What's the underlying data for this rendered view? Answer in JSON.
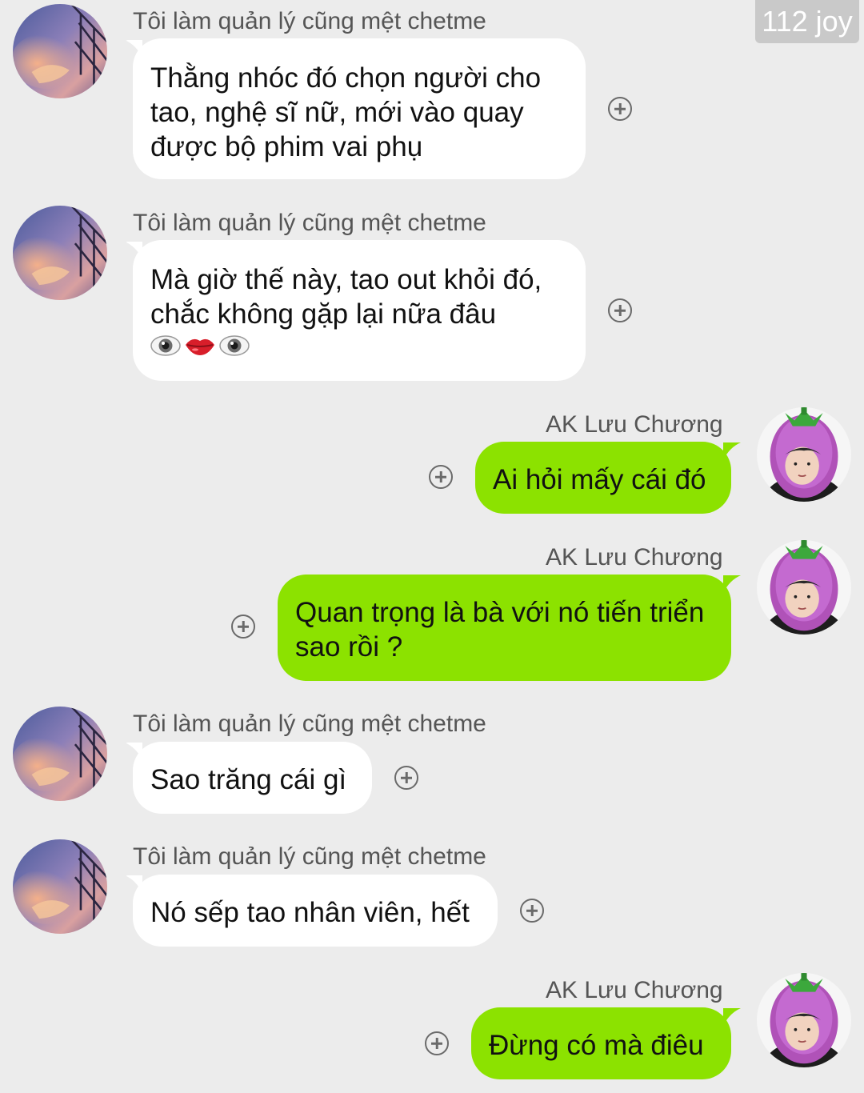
{
  "watermark": "112 joy",
  "colors": {
    "background": "#ececec",
    "incoming_bubble": "#ffffff",
    "outgoing_bubble": "#8ce200"
  },
  "contacts": {
    "other": {
      "name": "Tôi làm quản lý cũng mệt chetme",
      "avatar_icon": "sunset-building-avatar"
    },
    "me": {
      "name": "AK Lưu Chương",
      "avatar_icon": "eggplant-hat-avatar"
    }
  },
  "messages": [
    {
      "sender": "Tôi làm quản lý cũng mệt chetme",
      "lines": [
        "Thằng nhóc đó chọn người cho",
        "tao, nghệ sĩ nữ, mới vào quay",
        "được bộ phim vai phụ"
      ]
    },
    {
      "sender": "Tôi làm quản lý cũng mệt chetme",
      "lines": [
        "Mà giờ thế này, tao out khỏi đó,",
        "chắc không gặp lại nữa đâu"
      ],
      "emoji": [
        "eye-emoji",
        "lips-emoji",
        "eye-emoji"
      ]
    },
    {
      "sender": "AK Lưu Chương",
      "lines": [
        "Ai hỏi mấy cái đó"
      ]
    },
    {
      "sender": "AK Lưu Chương",
      "lines": [
        "Quan trọng là bà với nó tiến triển",
        "sao rồi ?"
      ]
    },
    {
      "sender": "Tôi làm quản lý cũng mệt chetme",
      "lines": [
        "Sao trăng cái gì"
      ]
    },
    {
      "sender": "Tôi làm quản lý cũng mệt chetme",
      "lines": [
        "Nó sếp tao nhân viên, hết"
      ]
    },
    {
      "sender": "AK Lưu Chương",
      "lines": [
        "Đừng có mà điêu"
      ]
    }
  ]
}
